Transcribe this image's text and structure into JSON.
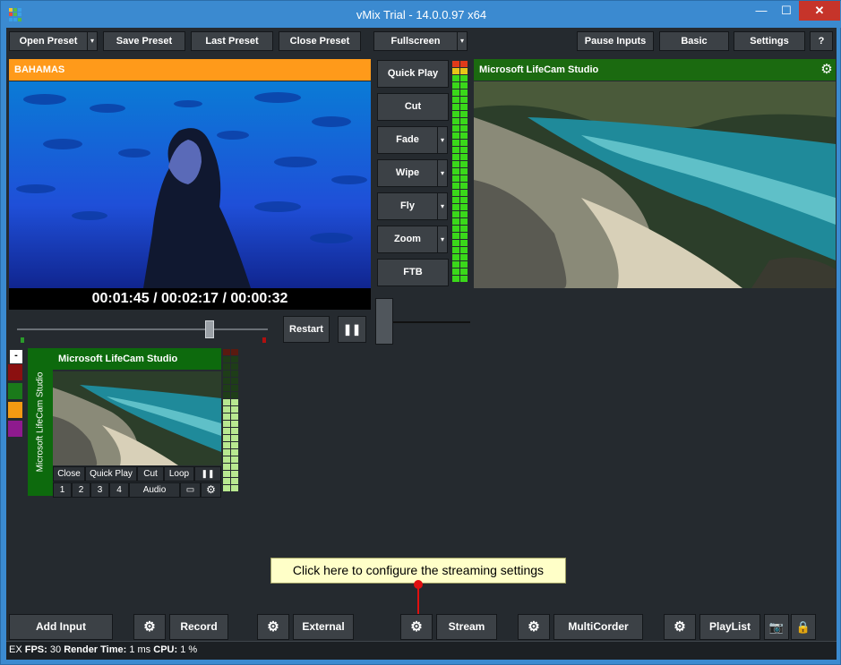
{
  "window": {
    "title": "vMix Trial - 14.0.0.97 x64",
    "min_glyph": "—",
    "max_glyph": "☐",
    "close_glyph": "✕"
  },
  "toolbar": {
    "open_preset": "Open Preset",
    "save_preset": "Save Preset",
    "last_preset": "Last Preset",
    "close_preset": "Close Preset",
    "fullscreen": "Fullscreen",
    "pause_inputs": "Pause Inputs",
    "basic": "Basic",
    "settings": "Settings",
    "help": "?"
  },
  "preview": {
    "title": "BAHAMAS",
    "timecode": "00:01:45  /  00:02:17  /  00:00:32",
    "restart": "Restart",
    "pause_glyph": "❚❚"
  },
  "transitions": {
    "quick_play": "Quick Play",
    "cut": "Cut",
    "fade": "Fade",
    "wipe": "Wipe",
    "fly": "Fly",
    "zoom": "Zoom",
    "ftb": "FTB",
    "dropdown_glyph": "▾"
  },
  "output": {
    "title": "Microsoft LifeCam Studio",
    "gear_glyph": "⚙"
  },
  "input1": {
    "title": "Microsoft LifeCam Studio",
    "side_label": "Microsoft LifeCam Studio",
    "close": "Close",
    "quick_play": "Quick Play",
    "cut": "Cut",
    "loop": "Loop",
    "pause_glyph": "❚❚",
    "n1": "1",
    "n2": "2",
    "n3": "3",
    "n4": "4",
    "audio": "Audio",
    "monitor_glyph": "▭",
    "gear_glyph": "⚙"
  },
  "color_tabs": {
    "minus": "-",
    "colors": [
      "#8b1010",
      "#1a7a1a",
      "#f39a12",
      "#8e1a8e"
    ]
  },
  "tooltip": {
    "text": "Click here to configure the streaming settings"
  },
  "bottom": {
    "add_input": "Add Input",
    "record": "Record",
    "external": "External",
    "stream": "Stream",
    "multicorder": "MultiCorder",
    "playlist": "PlayList",
    "gear_glyph": "⚙",
    "camera_glyph": "📷",
    "lock_glyph": "🔒"
  },
  "status": {
    "ex": "EX",
    "fps_label": "FPS:",
    "fps_value": "30",
    "render_label": "Render Time:",
    "render_value": "1 ms",
    "cpu_label": "CPU:",
    "cpu_value": "1 %"
  },
  "colors": {
    "preview_header": "#ff9a1a",
    "output_header": "#1b6a10",
    "input_header": "#0d6a0d",
    "accent_blue": "#3b8ad0"
  }
}
